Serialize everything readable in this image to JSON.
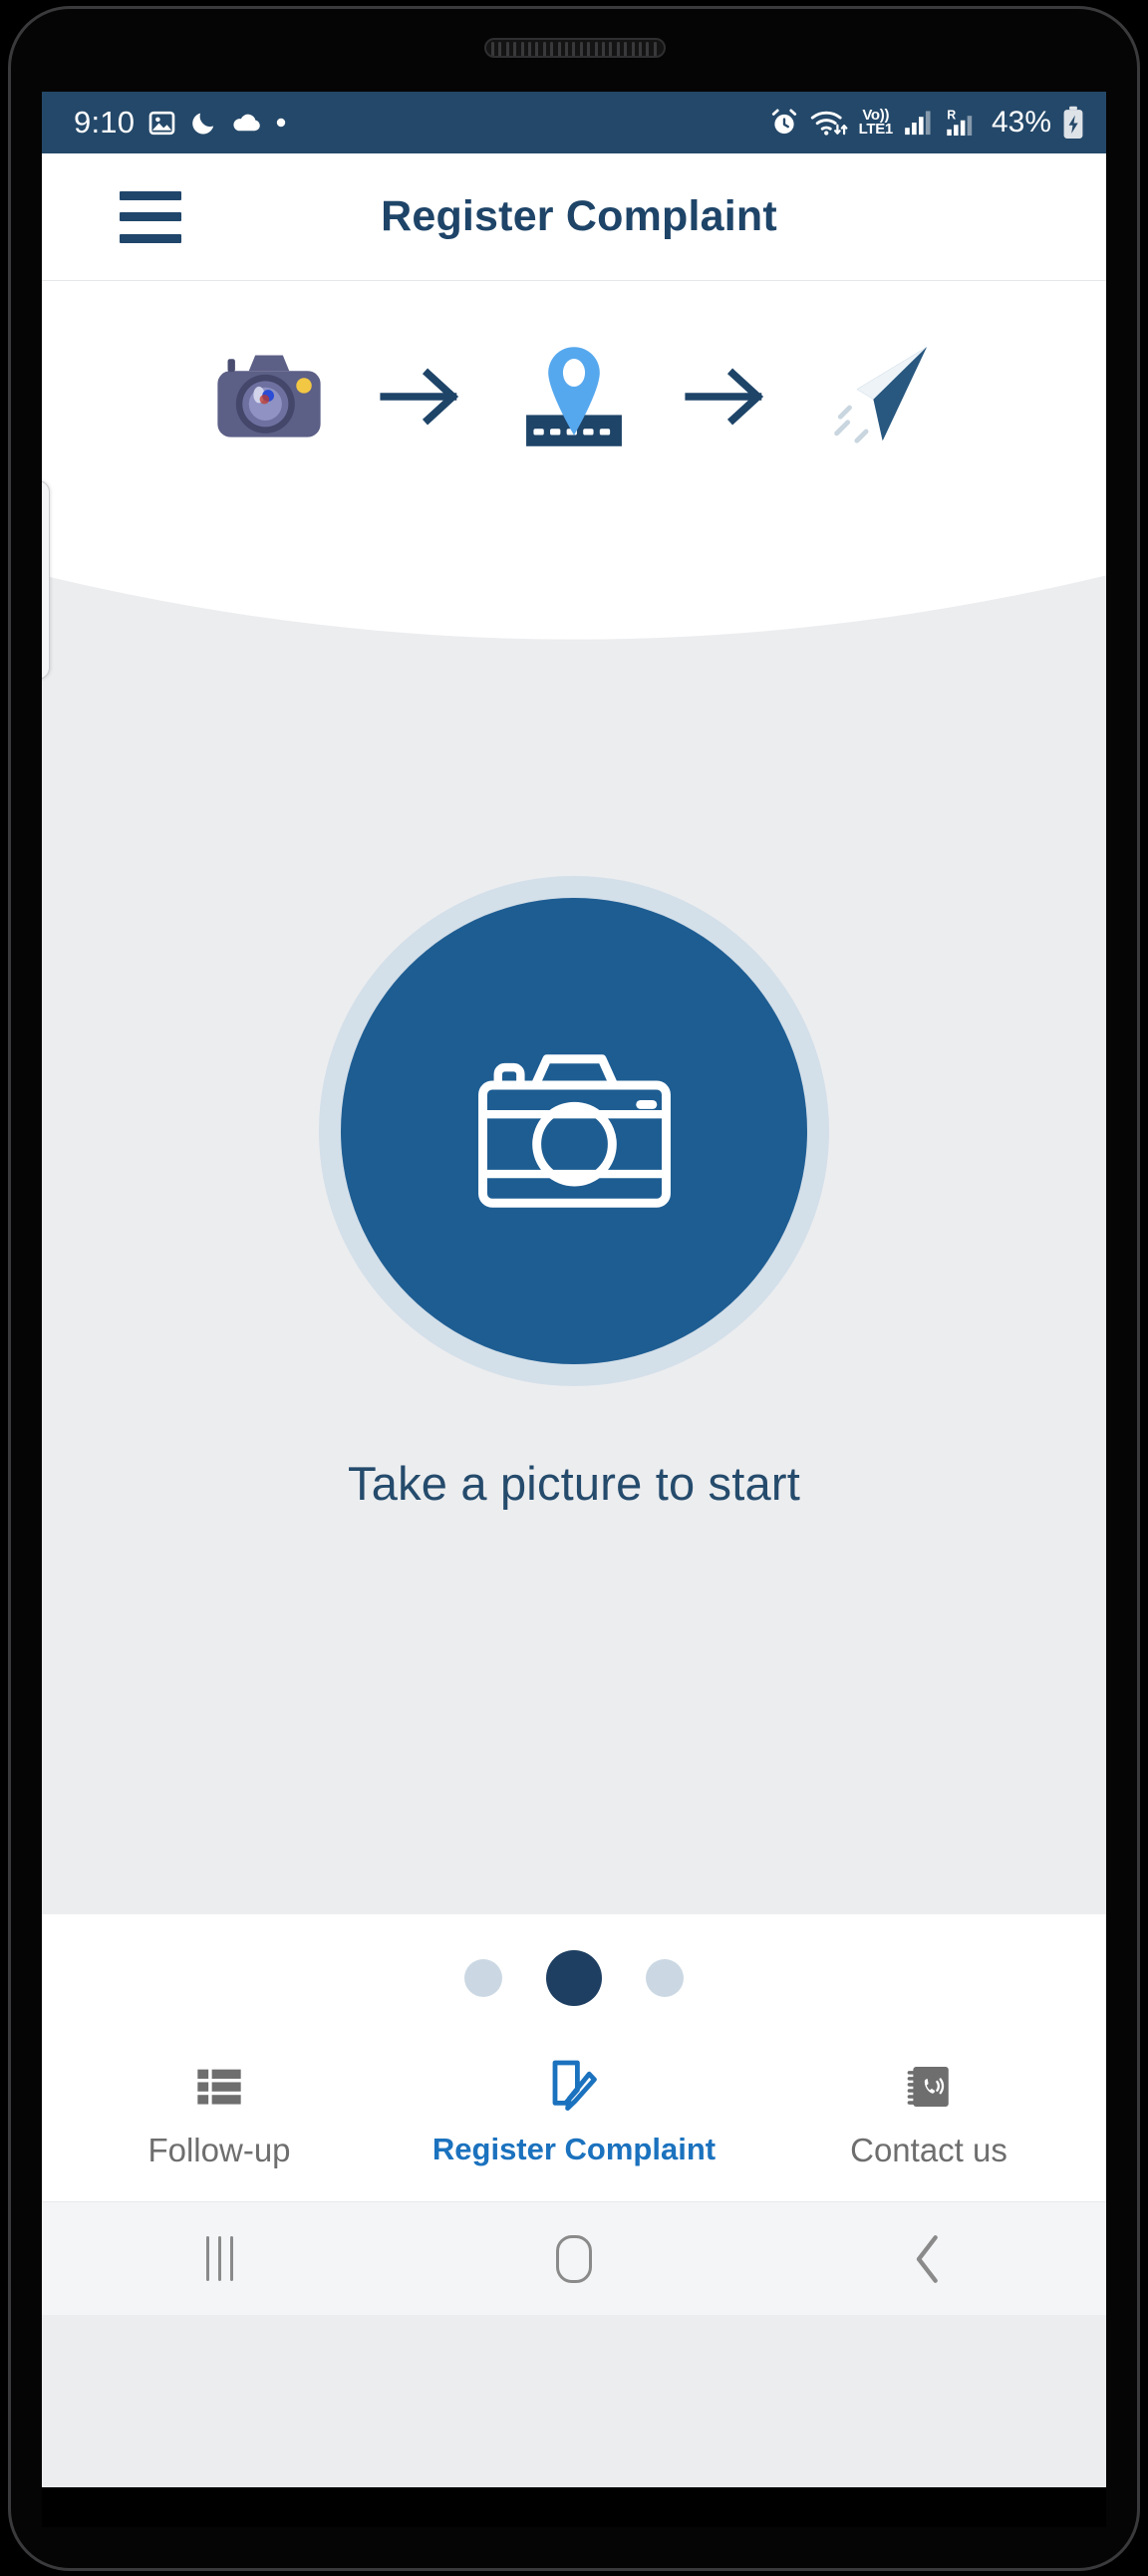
{
  "status_bar": {
    "time": "9:10",
    "left_icons": [
      "image-icon",
      "moon-icon",
      "cloud-icon",
      "dot-icon"
    ],
    "alarm_icon": "alarm-icon",
    "wifi_icon": "wifi-icon",
    "volte_top": "Vo))",
    "volte_bottom": "LTE1",
    "roaming_label": "R",
    "battery_percent": "43%",
    "battery_icon": "battery-charging-icon",
    "background_color": "#244869"
  },
  "app_bar": {
    "menu_label": "menu",
    "title": "Register Complaint",
    "title_color": "#1E4468"
  },
  "steps": [
    {
      "name": "camera",
      "icon": "camera-photo-icon"
    },
    {
      "name": "arrow-1",
      "icon": "arrow-right-icon"
    },
    {
      "name": "location",
      "icon": "location-pin-road-icon"
    },
    {
      "name": "arrow-2",
      "icon": "arrow-right-icon"
    },
    {
      "name": "submit",
      "icon": "paper-plane-icon"
    }
  ],
  "main": {
    "capture_icon": "camera-outline-icon",
    "capture_hint": "Take a picture to start",
    "button_color": "#1E5D92",
    "button_ring_color": "#D3DFE9",
    "background_color": "#ECEDEF"
  },
  "pager": {
    "total": 3,
    "active_index": 1,
    "active_color": "#1E3F62",
    "inactive_color": "#CBD8E3"
  },
  "bottom_nav": {
    "active_index": 1,
    "active_color": "#1B72BE",
    "inactive_color": "#6E6E6E",
    "tabs": [
      {
        "label": "Follow-up",
        "icon": "list-icon",
        "active": false
      },
      {
        "label": "Register Complaint",
        "icon": "note-pencil-icon",
        "active": true
      },
      {
        "label": "Contact us",
        "icon": "contact-book-icon",
        "active": false
      }
    ]
  },
  "system_nav": {
    "recents": "recents-icon",
    "home": "home-icon",
    "back": "back-icon"
  }
}
